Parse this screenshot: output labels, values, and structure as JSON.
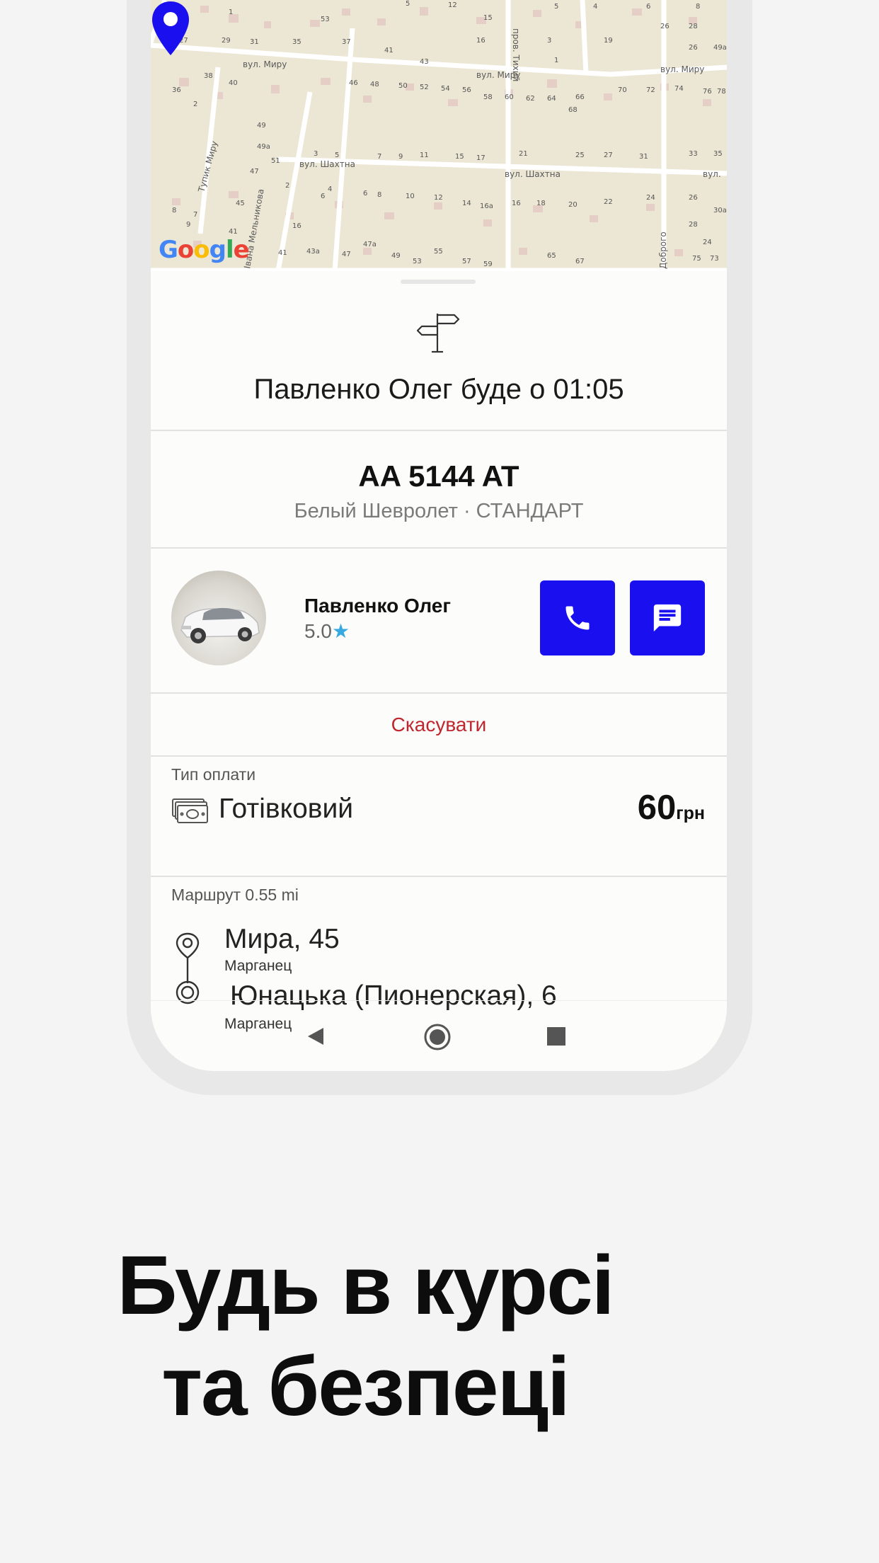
{
  "map": {
    "street_mira_left": "вул. Миру",
    "street_mira_center": "вул. Миру",
    "street_mira_right": "вул. Миру",
    "street_shakhtna_left": "вул. Шахтна",
    "street_shakhtna_center": "вул. Шахтна",
    "street_shakhtna_right": "вул.",
    "lane_tykhyi": "пров. Тихий",
    "lane_myru": "Тупик Миру",
    "street_melnykova": "Івана Мельникова",
    "street_dobroho": "Доброго",
    "logo_text": "Google"
  },
  "trip": {
    "arrival_text": "Павленко Олег буде о 01:05",
    "plate": "AA 5144 AT",
    "car_description": "Белый Шевролет · СТАНДАРТ"
  },
  "driver": {
    "name": "Павленко Олег",
    "rating": "5.0",
    "star": "★"
  },
  "actions": {
    "cancel_label": "Скасувати"
  },
  "payment": {
    "label": "Тип оплати",
    "method": "Готівковий",
    "amount": "60",
    "currency": "грн"
  },
  "route": {
    "label": "Маршрут 0.55 mi",
    "stops": [
      {
        "address": "Мира, 45",
        "city": "Марганец"
      },
      {
        "address": " Юнацька (Пионерская), 6",
        "city": "Марганец"
      }
    ]
  },
  "headline": {
    "line1": "Будь в курсі",
    "line2": "та безпеці"
  },
  "colors": {
    "accent": "#1a10ef",
    "cancel": "#c0262e",
    "star": "#35a9e0"
  }
}
